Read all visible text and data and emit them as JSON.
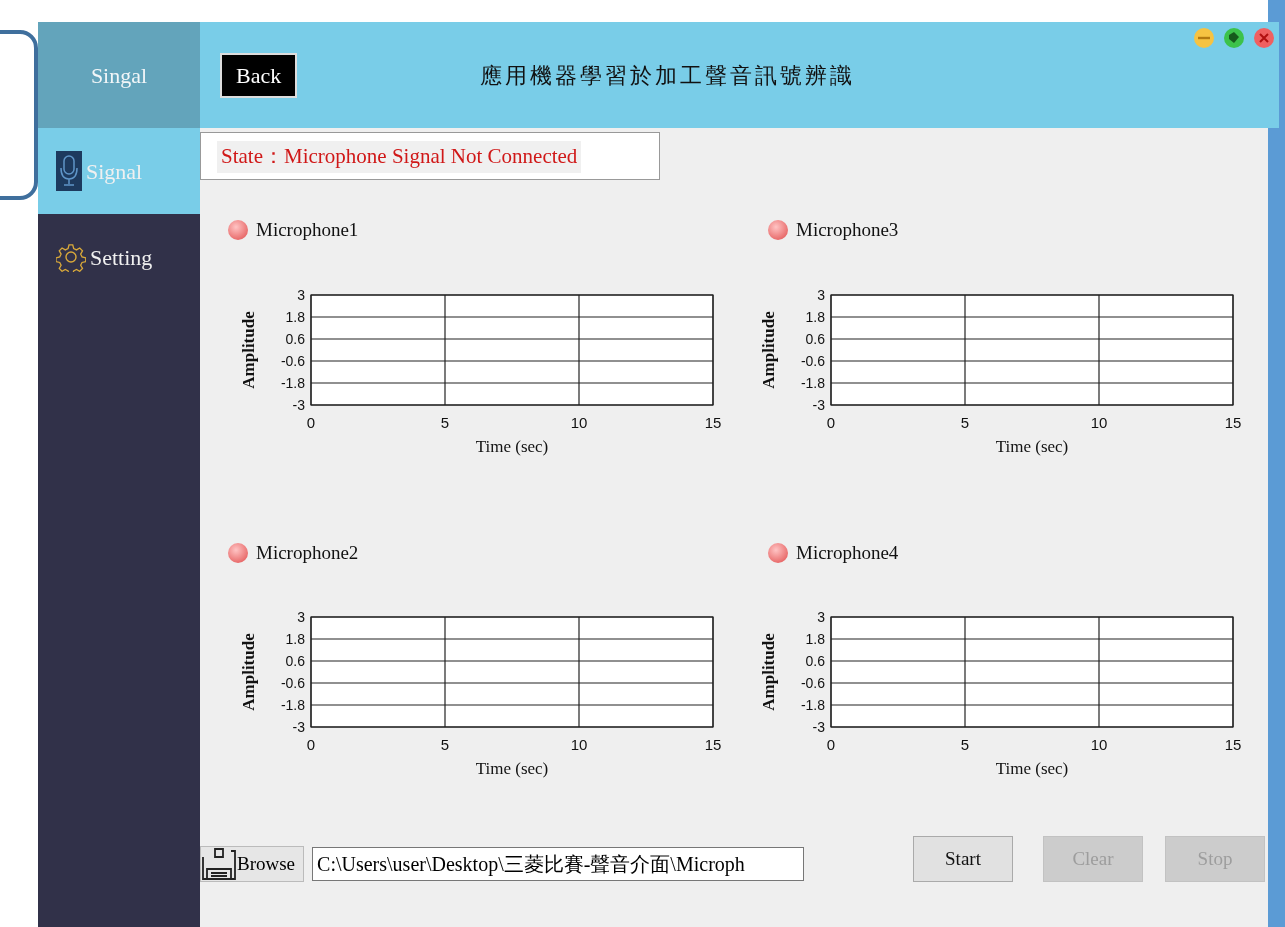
{
  "sidebar": {
    "brand": "Singal",
    "items": [
      {
        "label": "Signal",
        "selected": true
      },
      {
        "label": "Setting",
        "selected": false
      }
    ]
  },
  "header": {
    "back_button": "Back",
    "title": "應用機器學習於加工聲音訊號辨識"
  },
  "status": "State：Microphone Signal Not Connected",
  "microphones": [
    {
      "name": "Microphone1",
      "connected": false,
      "chart_data": {
        "type": "line",
        "grid": true,
        "xlabel": "Time (sec)",
        "ylabel": "Amplitude",
        "xlim": [
          0,
          15
        ],
        "ylim": [
          -3,
          3
        ],
        "xticks": [
          0,
          5,
          10,
          15
        ],
        "yticks": [
          3,
          1.8,
          0.6,
          -0.6,
          -1.8,
          -3
        ]
      }
    },
    {
      "name": "Microphone3",
      "connected": false,
      "chart_data": {
        "type": "line",
        "grid": true,
        "xlabel": "Time (sec)",
        "ylabel": "Amplitude",
        "xlim": [
          0,
          15
        ],
        "ylim": [
          -3,
          3
        ],
        "xticks": [
          0,
          5,
          10,
          15
        ],
        "yticks": [
          3,
          1.8,
          0.6,
          -0.6,
          -1.8,
          -3
        ]
      }
    },
    {
      "name": "Microphone2",
      "connected": false,
      "chart_data": {
        "type": "line",
        "grid": true,
        "xlabel": "Time (sec)",
        "ylabel": "Amplitude",
        "xlim": [
          0,
          15
        ],
        "ylim": [
          -3,
          3
        ],
        "xticks": [
          0,
          5,
          10,
          15
        ],
        "yticks": [
          3,
          1.8,
          0.6,
          -0.6,
          -1.8,
          -3
        ]
      }
    },
    {
      "name": "Microphone4",
      "connected": false,
      "chart_data": {
        "type": "line",
        "grid": true,
        "xlabel": "Time (sec)",
        "ylabel": "Amplitude",
        "xlim": [
          0,
          15
        ],
        "ylim": [
          -3,
          3
        ],
        "xticks": [
          0,
          5,
          10,
          15
        ],
        "yticks": [
          3,
          1.8,
          0.6,
          -0.6,
          -1.8,
          -3
        ]
      }
    }
  ],
  "file": {
    "browse_button": "Browse",
    "path": "C:\\Users\\user\\Desktop\\三菱比賽-聲音介面\\Microph"
  },
  "buttons": [
    {
      "label": "Start",
      "disabled": false
    },
    {
      "label": "Clear",
      "disabled": true
    },
    {
      "label": "Stop",
      "disabled": true
    }
  ]
}
